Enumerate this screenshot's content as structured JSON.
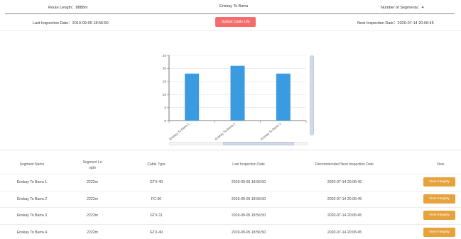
{
  "header": {
    "route_length": "Route Length：8888m",
    "route_name": "Eriskay To Barra",
    "segments_count": "Number of Segments：4",
    "last_inspection": "Last Inspection Date：2019-09-05 18:56:50",
    "update_button": "Update Cable Life",
    "next_inspection": "Next Inspection Date：2020-07-14 20:06:45"
  },
  "chart_data": {
    "type": "bar",
    "categories": [
      "Eriskay To Barra 1",
      "Eriskay To Barra 2",
      "Eriskay To Barra 3"
    ],
    "category_tick_labels": [
      "Eriskay To Barra 1",
      "Eriskay To Barra 2",
      "Eriskay To Barra 3"
    ],
    "values": [
      18,
      21,
      18
    ],
    "ylim": [
      0,
      25
    ],
    "yticks": [
      0,
      5,
      10,
      15,
      20,
      25
    ],
    "title": "",
    "xlabel": "",
    "ylabel": "",
    "grid": true,
    "bar_color": "#3a9be0"
  },
  "table": {
    "headers": {
      "name": "Segment Name",
      "length_line1": "Segment Le",
      "length_line2": "ngth",
      "cable_type": "Cable Type",
      "last_date": "Last Inspection Date",
      "next_date": "Recommended Next Inspection Date",
      "view": "View"
    },
    "rows": [
      {
        "name": "Eriskay To Barra 1",
        "length": "2222m",
        "cable_type": "GTX-40",
        "last": "2019-09-05 18:56:50",
        "next": "2020-07-14 20:06:45",
        "action": "View Integrity"
      },
      {
        "name": "Eriskay To Barra 2",
        "length": "2222m",
        "cable_type": "FC-30",
        "last": "2019-09-05 18:56:50",
        "next": "2020-07-14 20:06:45",
        "action": "View Integrity"
      },
      {
        "name": "Eriskay To Barra 3",
        "length": "2222m",
        "cable_type": "GTX-11",
        "last": "2019-09-05 18:56:50",
        "next": "2020-07-14 20:06:45",
        "action": "View Integrity"
      },
      {
        "name": "Eriskay To Barra 4",
        "length": "2222m",
        "cable_type": "GTX-40",
        "last": "2019-09-05 18:56:50",
        "next": "2020-07-14 20:06:45",
        "action": "View Integrity"
      }
    ]
  },
  "colors": {
    "danger": "#f56c6c",
    "warning": "#e6a23c",
    "bar": "#3a9be0"
  }
}
